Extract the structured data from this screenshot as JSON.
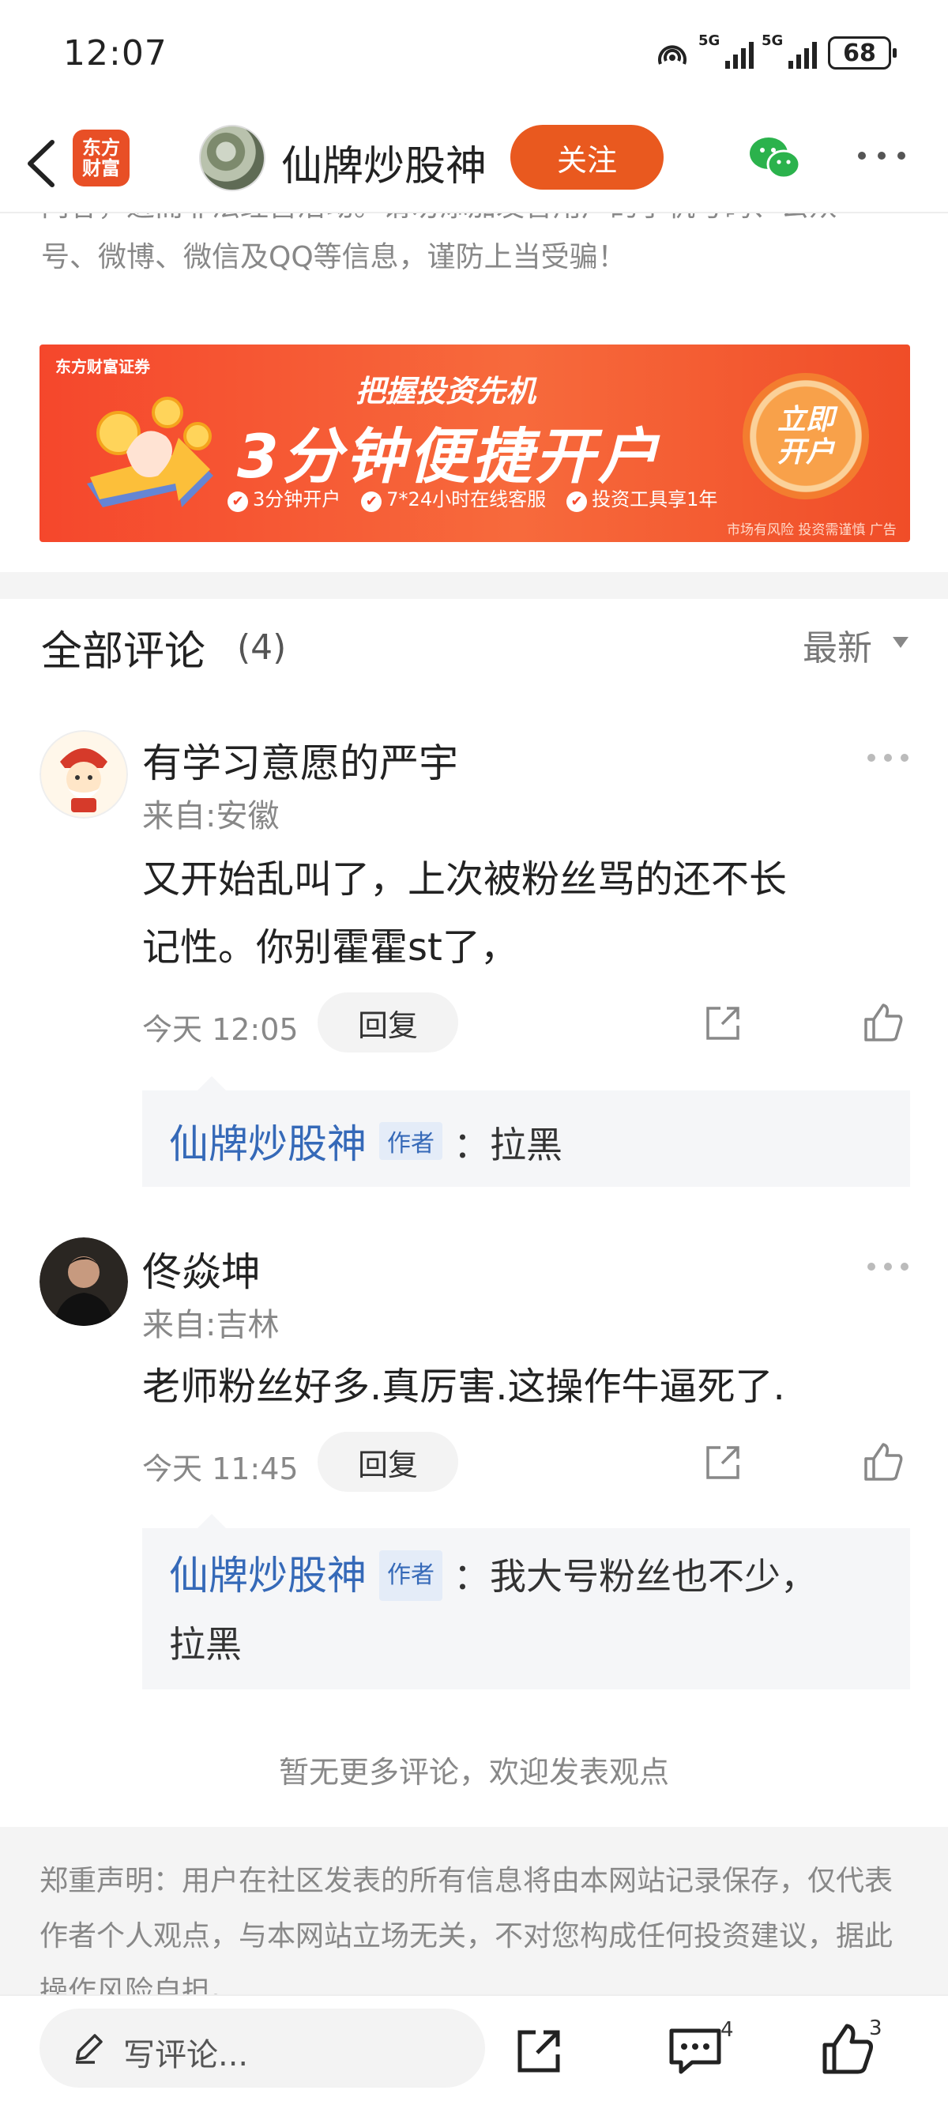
{
  "status": {
    "time": "12:07",
    "battery": "68",
    "sig1_label": "5G",
    "sig2_label": "5G"
  },
  "nav": {
    "logo_line1": "东方",
    "logo_line2": "财富",
    "title": "仙牌炒股神",
    "follow_label": "关注"
  },
  "notice": {
    "line1": "内容，进而非法经营活动。请勿添加发言用户的手机号码、公众",
    "line2": "号、微博、微信及QQ等信息，谨防上当受骗！"
  },
  "banner": {
    "brand": "东方财富证券",
    "headline": "把握投资先机",
    "big": "3分钟便捷开户",
    "features": [
      "3分钟开户",
      "7*24小时在线客服",
      "投资工具享1年"
    ],
    "cta_line1": "立即",
    "cta_line2": "开户",
    "risk": "市场有风险 投资需谨慎 广告"
  },
  "comments_header": {
    "title": "全部评论",
    "count": "(4)",
    "sort": "最新"
  },
  "comments": [
    {
      "name": "有学习意愿的严宇",
      "from": "来自:安徽",
      "text_line1": "又开始乱叫了，上次被粉丝骂的还不长",
      "text_line2": "记性。你别霍霍st了，",
      "time": "今天 12:05",
      "reply_label": "回复",
      "reply": {
        "author": "仙牌炒股神",
        "tag": "作者",
        "text": "：拉黑"
      }
    },
    {
      "name": "佟焱坤",
      "from": "来自:吉林",
      "text_line1": "老师粉丝好多.真厉害.这操作牛逼死了.",
      "time": "今天 11:45",
      "reply_label": "回复",
      "reply": {
        "author": "仙牌炒股神",
        "tag": "作者",
        "text": "：我大号粉丝也不少，",
        "text2": "拉黑"
      }
    }
  ],
  "no_more": "暂无更多评论，欢迎发表观点",
  "disclaimer": "郑重声明：用户在社区发表的所有信息将由本网站记录保存，仅代表作者个人观点，与本网站立场无关，不对您构成任何投资建议，据此操作风险自担。",
  "bottom": {
    "placeholder": "写评论...",
    "comment_count": "4",
    "like_count": "3"
  },
  "colors": {
    "accent": "#e9591f",
    "author_blue": "#3569b8"
  }
}
